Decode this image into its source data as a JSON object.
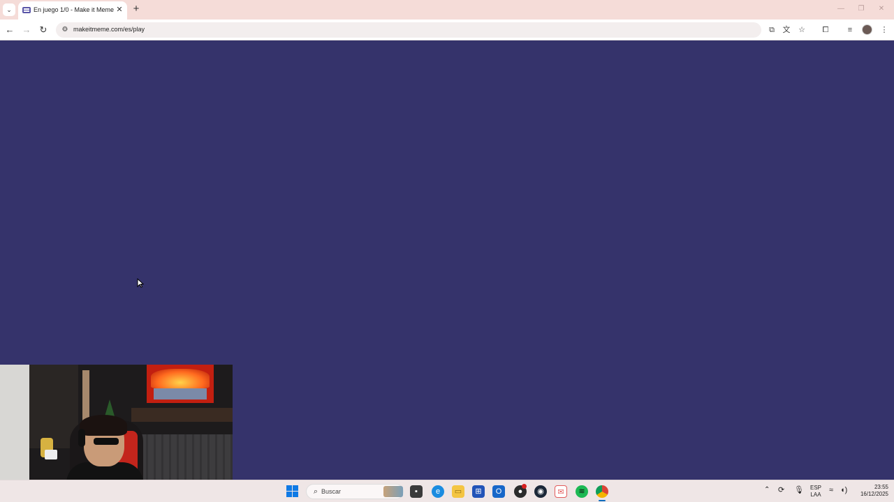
{
  "browser": {
    "tab": {
      "title": "En juego 1/0 - Make it Meme",
      "close": "✕"
    },
    "new_tab": "+",
    "window_controls": {
      "minimize": "—",
      "maximize": "❐",
      "close": "✕"
    },
    "nav": {
      "back": "←",
      "forward": "→",
      "reload": "↻"
    },
    "url": "makeitmeme.com/es/play",
    "toolbar_icons": [
      "install-app-icon",
      "translate-icon",
      "bookmark-star-icon",
      "extensions-icon",
      "reading-list-icon",
      "profile-avatar",
      "more-menu-icon"
    ]
  },
  "page": {
    "background": "#35336b"
  },
  "taskbar": {
    "search_placeholder": "Buscar",
    "language": {
      "line1": "ESP",
      "line2": "LAA"
    },
    "clock": {
      "time": "23:55",
      "date": "16/12/2025"
    },
    "apps": [
      "start-icon",
      "explorer-icon",
      "edge-icon",
      "files-icon",
      "store-icon",
      "outlook-icon",
      "obs-icon",
      "steam-icon",
      "mail-icon",
      "spotify-icon",
      "chrome-icon"
    ]
  }
}
